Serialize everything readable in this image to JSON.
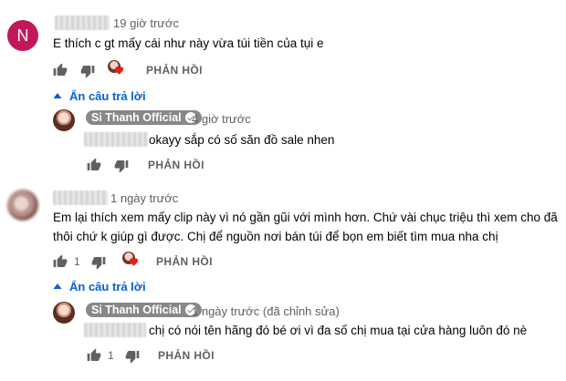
{
  "comments": [
    {
      "avatar_letter": "N",
      "avatar_color": "#c2185b",
      "time": "19 giờ trước",
      "text": "E thích c gt mấy cái như này vừa túi tiền của tụi e",
      "reply_label": "PHẢN HỒI",
      "toggle_label": "Ẩn câu trả lời",
      "reply": {
        "author": "Si Thanh Official",
        "time": "4 giờ trước",
        "text": "okayy sắp có số săn đồ sale nhen",
        "reply_label": "PHẢN HỒI"
      }
    },
    {
      "time": "1 ngày trước",
      "text_line1": "Em lại thích xem mấy clip này vì nó gần gũi với mình hơn. Chứ vài chục triệu thì xem cho đã",
      "text_line2": "thôi chứ k giúp gì được. Chị để nguồn nơi bán túi để bọn em biết tìm mua nha chị",
      "likes": "1",
      "reply_label": "PHẢN HỒI",
      "toggle_label": "Ẩn câu trả lời",
      "reply": {
        "author": "Si Thanh Official",
        "time": "1 ngày trước (đã chỉnh sửa)",
        "text": "chị có nói tên hãng đó bé ơi vì đa số chị mua tại cửa hàng luôn đó nè",
        "likes": "1",
        "reply_label": "PHẢN HỒI"
      }
    }
  ],
  "colors": {
    "link": "#065fd4",
    "meta": "#606060",
    "badge": "#888888",
    "heart": "#e62117"
  },
  "icons": [
    "like-icon",
    "dislike-icon",
    "creator-heart-icon",
    "caret-up-icon",
    "verified-check-icon"
  ]
}
